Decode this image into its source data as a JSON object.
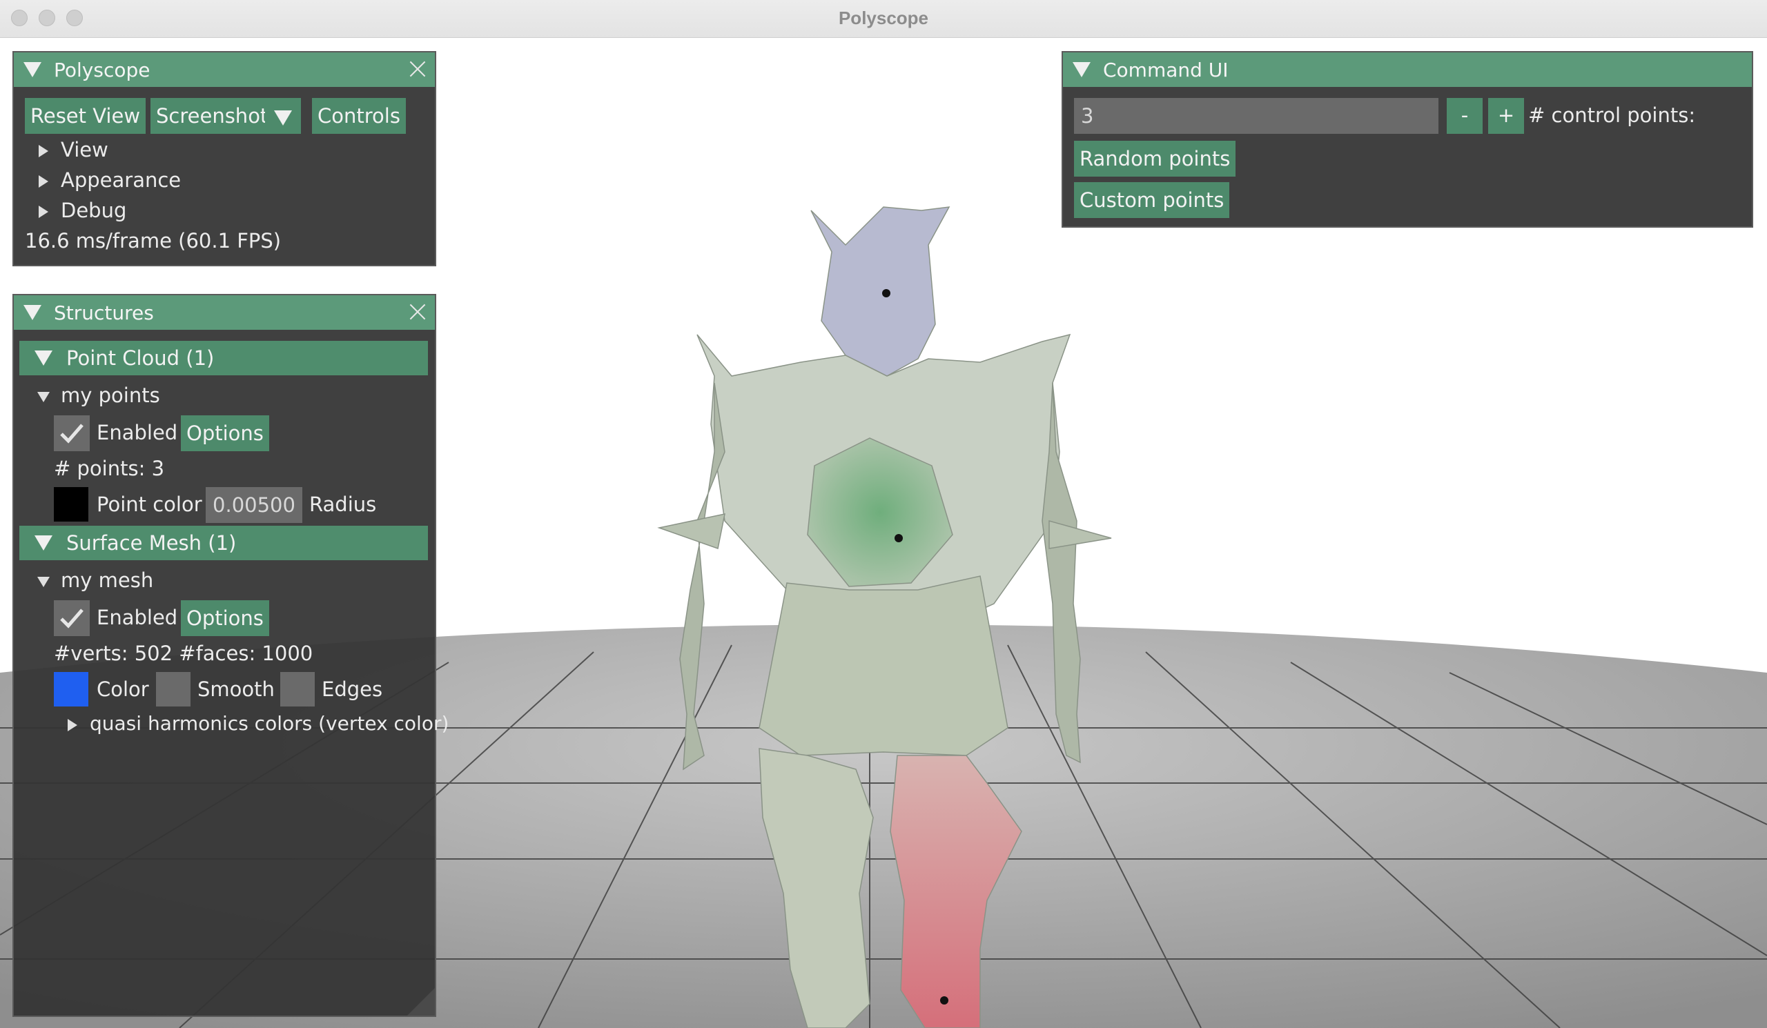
{
  "window": {
    "title": "Polyscope"
  },
  "polyscope_panel": {
    "title": "Polyscope",
    "buttons": {
      "reset_view": "Reset View",
      "screenshot": "Screenshot",
      "controls": "Controls"
    },
    "tree": [
      "View",
      "Appearance",
      "Debug"
    ],
    "fps": "16.6 ms/frame (60.1 FPS)"
  },
  "structures_panel": {
    "title": "Structures",
    "point_cloud": {
      "section": "Point Cloud (1)",
      "name": "my points",
      "enabled_label": "Enabled",
      "enabled": true,
      "options_label": "Options",
      "info": "# points: 3",
      "color_label": "Point color",
      "color": "#000000",
      "radius_value": "0.00500",
      "radius_label": "Radius"
    },
    "surface_mesh": {
      "section": "Surface Mesh (1)",
      "name": "my mesh",
      "enabled_label": "Enabled",
      "enabled": true,
      "options_label": "Options",
      "info": "#verts: 502  #faces: 1000",
      "color_label": "Color",
      "color": "#1f5ff0",
      "smooth_label": "Smooth",
      "edges_label": "Edges",
      "quantity": "quasi harmonics colors (vertex color)"
    }
  },
  "command_ui": {
    "title": "Command UI",
    "control_points_value": "3",
    "minus": "-",
    "plus": "+",
    "control_points_label": "# control points:",
    "random_points": "Random points",
    "custom_points": "Custom points"
  },
  "colors": {
    "header": "#5c9a7a",
    "button": "#4d8a6b",
    "panel": "#343434"
  }
}
